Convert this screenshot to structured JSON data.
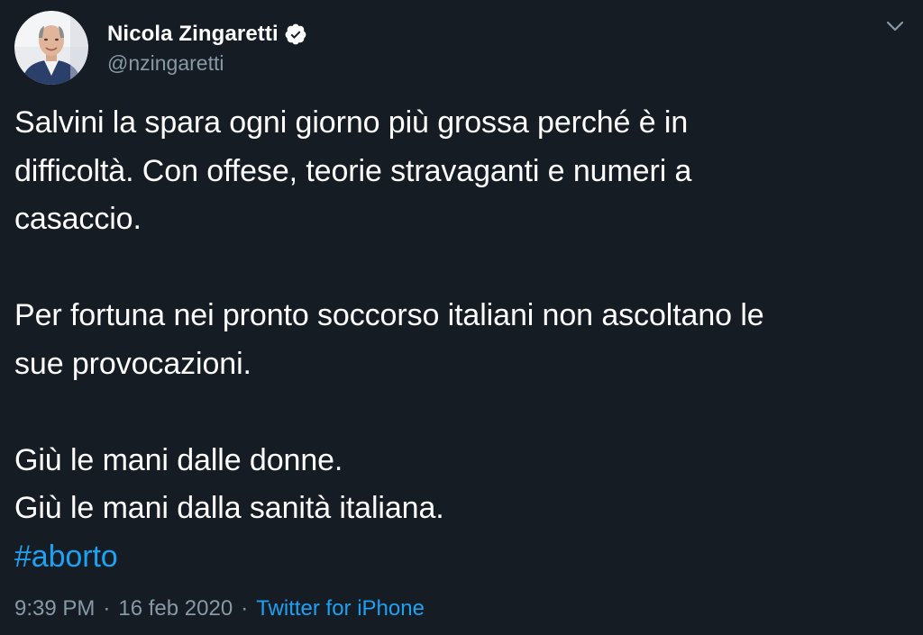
{
  "tweet": {
    "author": {
      "display_name": "Nicola Zingaretti",
      "handle": "@nzingaretti",
      "verified": true,
      "avatar": "profile-photo"
    },
    "menu_icon": "chevron-down-icon",
    "text_lines": {
      "p1_l1": "Salvini la spara ogni giorno più grossa perché è in",
      "p1_l2": "difficoltà. Con offese, teorie stravaganti e numeri a",
      "p1_l3": "casaccio.",
      "p2_l1": "Per fortuna nei pronto soccorso italiani non ascoltano le",
      "p2_l2": "sue provocazioni.",
      "p3_l1": "Giù le mani dalle donne.",
      "p3_l2": "Giù le mani dalla sanità italiana."
    },
    "hashtag": "#aborto",
    "time": "9:39 PM",
    "date": "16 feb 2020",
    "separator": "·",
    "source": "Twitter for iPhone"
  },
  "colors": {
    "background": "#151c24",
    "text": "#ffffff",
    "secondary": "#8899a6",
    "link": "#1da1f2"
  }
}
